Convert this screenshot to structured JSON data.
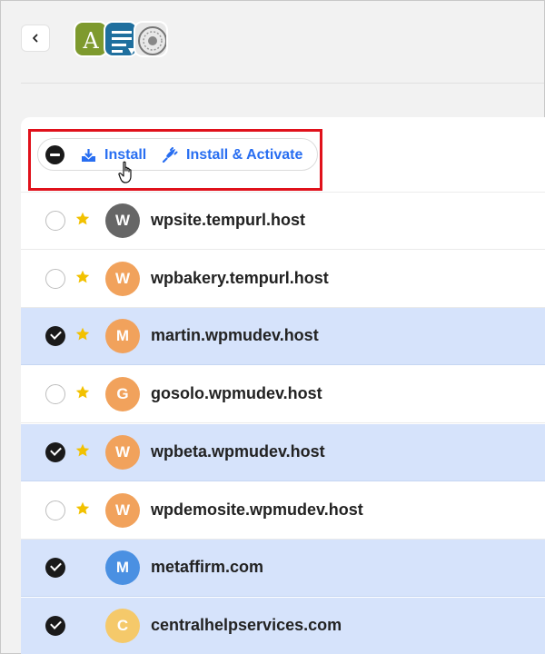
{
  "header": {
    "back_icon": "chevron-left-icon",
    "plugin_icons": [
      {
        "name": "plugin-icon-a",
        "letter": "A",
        "color": "#7e9a2e"
      },
      {
        "name": "plugin-icon-list",
        "color": "#1f6f9e"
      },
      {
        "name": "plugin-icon-seal",
        "color": "#e8e8e8"
      }
    ]
  },
  "bulk_actions": {
    "install_label": "Install",
    "install_activate_label": "Install & Activate",
    "accent_color": "#286ef1",
    "highlight_color": "#e0111b"
  },
  "sites": [
    {
      "initial": "W",
      "name": "wpsite.tempurl.host",
      "starred": true,
      "selected": false,
      "avatar_color": "#666666"
    },
    {
      "initial": "W",
      "name": "wpbakery.tempurl.host",
      "starred": true,
      "selected": false,
      "avatar_color": "#f1a25c"
    },
    {
      "initial": "M",
      "name": "martin.wpmudev.host",
      "starred": true,
      "selected": true,
      "avatar_color": "#f1a25c"
    },
    {
      "initial": "G",
      "name": "gosolo.wpmudev.host",
      "starred": true,
      "selected": false,
      "avatar_color": "#f1a25c"
    },
    {
      "initial": "W",
      "name": "wpbeta.wpmudev.host",
      "starred": true,
      "selected": true,
      "avatar_color": "#f1a25c"
    },
    {
      "initial": "W",
      "name": "wpdemosite.wpmudev.host",
      "starred": true,
      "selected": false,
      "avatar_color": "#f1a25c"
    },
    {
      "initial": "M",
      "name": "metaffirm.com",
      "starred": false,
      "selected": true,
      "avatar_color": "#4a90e2"
    },
    {
      "initial": "C",
      "name": "centralhelpservices.com",
      "starred": false,
      "selected": true,
      "avatar_color": "#f5c96a"
    }
  ],
  "colors": {
    "selected_row": "#d6e3fb",
    "star": "#f2c100"
  }
}
